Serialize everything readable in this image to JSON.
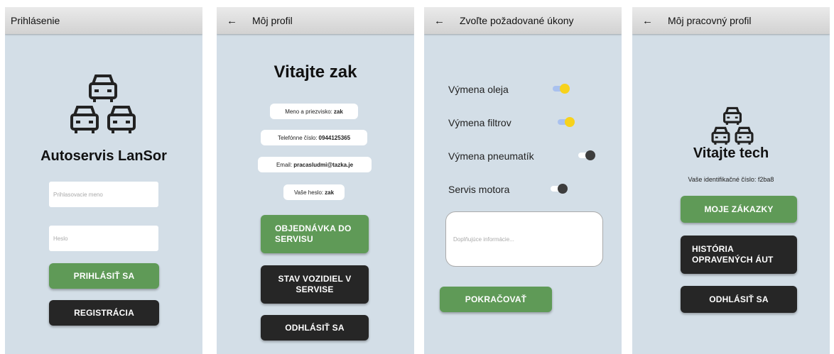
{
  "login": {
    "title": "Prihlásenie",
    "brand": "Autoservis LanSor",
    "username_placeholder": "Prihlasovacie meno",
    "password_placeholder": "Heslo",
    "login_button": "PRIHLÁSIŤ SA",
    "register_button": "REGISTRÁCIA"
  },
  "profile": {
    "back": "←",
    "title": "Môj profil",
    "welcome": "Vitajte zak",
    "name_label": "Meno a priezvisko:",
    "name_value": "zak",
    "phone_label": "Telefónne číslo:",
    "phone_value": "0944125365",
    "email_label": "Email:",
    "email_value": "pracasludmi@tazka.je",
    "password_label": "Vaše heslo:",
    "password_value": "zak",
    "order_button_l1": "OBJEDNÁVKA DO",
    "order_button_l2": "SERVISU",
    "status_button_l1": "STAV VOZIDIEL V",
    "status_button_l2": "SERVISE",
    "logout_button": "ODHLÁSIŤ SA"
  },
  "tasks": {
    "back": "←",
    "title": "Zvoľte požadované úkony",
    "items": [
      {
        "label": "Výmena oleja",
        "on": true
      },
      {
        "label": "Výmena filtrov",
        "on": true
      },
      {
        "label": "Výmena pneumatík",
        "on": false
      },
      {
        "label": "Servis motora",
        "on": false
      }
    ],
    "info_placeholder": "Doplňujúce informácie...",
    "continue_button": "POKRAČOVAŤ"
  },
  "work": {
    "back": "←",
    "title": "Môj pracovný profil",
    "welcome": "Vitajte tech",
    "id_text": "Vaše identifikačné číslo: f2ba8",
    "orders_button": "MOJE ZÁKAZKY",
    "history_button_l1": "HISTÓRIA",
    "history_button_l2": "OPRAVENÝCH ÁUT",
    "logout_button": "ODHLÁSIŤ SA"
  },
  "colors": {
    "background": "#d3dee7",
    "green": "#5f9a57",
    "dark": "#262626",
    "toggle_on": "#f7d21c"
  },
  "icons": [
    "cars-logo-icon",
    "back-arrow-icon"
  ]
}
